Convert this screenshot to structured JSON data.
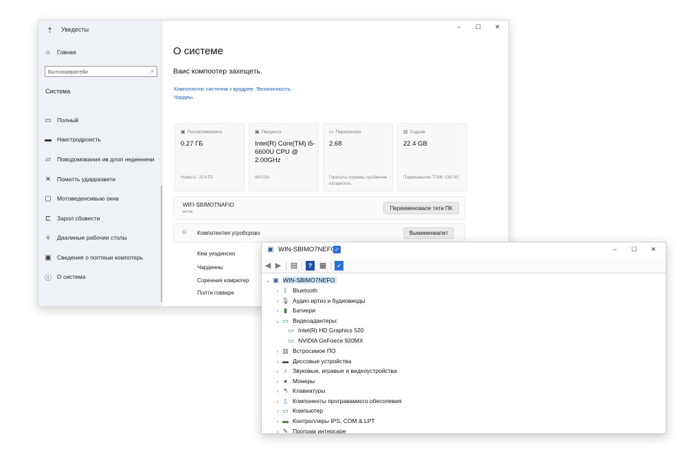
{
  "settings": {
    "app_title": "Уведесты",
    "back_icon": "back-arrow-icon",
    "window_controls": [
      "–",
      "☐",
      "✕"
    ],
    "sidebar": {
      "home": "Глвная",
      "search_placeholder": "Бытснорвратейи",
      "section": "Система",
      "items": [
        {
          "label": "Полный",
          "icon": "display-icon"
        },
        {
          "label": "Накстродроисть",
          "icon": "sound-icon"
        },
        {
          "label": "Поводомования ив длоп неденнени",
          "icon": "notifications-icon"
        },
        {
          "label": "Поматть ударразвети",
          "icon": "focus-assist-icon"
        },
        {
          "label": "Мотоведеисивыю окна",
          "icon": "power-icon"
        },
        {
          "label": "Зарол сбовести",
          "icon": "storage-icon"
        },
        {
          "label": "Даалиные рабочии столы",
          "icon": "multitasking-icon"
        },
        {
          "label": "Сведения о поптеыи компотерь",
          "icon": "projecting-icon"
        },
        {
          "label": "О система",
          "icon": "info-icon"
        }
      ]
    },
    "main": {
      "title": "О системе",
      "protected": "Ваис компоотер захещеть.",
      "link_line1": "Компотиотис систенна з вродрев- 'Везиничность.",
      "link_line2": "Чордиы.",
      "cards": [
        {
          "label": "Поспатименията",
          "value": "0.27 ГБ",
          "note": "Новесть: 32.8 ГБ"
        },
        {
          "label": "Пвоцеото",
          "value": "Intel(R) Core(TM) i5-6600U CPU @ 2.00GHz",
          "note": "WII-Oiis"
        },
        {
          "label": "Периоинтро",
          "value": "2.68",
          "note": "Горесола лоувамы прсбжение изпаритиль"
        },
        {
          "label": "Содозв",
          "value": "22.4 GB",
          "note": "Порминикатие ТГ8Ф, С63 90"
        }
      ],
      "pc_name": "WIFI-SBIMOTNAFIO",
      "pc_name_sub": "вктик",
      "rename_button": "Переименовале тети ПК",
      "device_row_label": "Компотентея угробсровз",
      "device_row_button": "Вымименвапит",
      "related": [
        "Кем уиздинсно",
        "Чарденны",
        "Соренния комрютер",
        "Полти говваре"
      ]
    }
  },
  "device_manager": {
    "title": "WIN-SBIMO7NEFO",
    "window_controls": [
      "–",
      "☐",
      "✕"
    ],
    "toolbar_icons": [
      "back-icon",
      "forward-icon",
      "properties-icon",
      "help-icon",
      "view-icon",
      "scan-icon"
    ],
    "root": "WIN-SBIMO7NEFO",
    "tree": [
      {
        "label": "Bluetooth",
        "icon": "bluetooth-icon",
        "expanded": false
      },
      {
        "label": "Аудио иртиз и будиовиоды",
        "icon": "audio-icon",
        "expanded": false
      },
      {
        "label": "Батиери",
        "icon": "battery-icon",
        "expanded": false
      },
      {
        "label": "Видеоадантеры:",
        "icon": "display-adapter-icon",
        "expanded": true,
        "children": [
          {
            "label": "Intel(R) HD Graphics 520",
            "icon": "gpu-icon"
          },
          {
            "label": "NVIDIA GeFoece 920MX",
            "icon": "gpu-icon"
          }
        ]
      },
      {
        "label": "Встросимое ПО",
        "icon": "firmware-icon",
        "expanded": false
      },
      {
        "label": "Диссовые устройства",
        "icon": "disk-icon",
        "expanded": false
      },
      {
        "label": "Звуковые, игравые и видеоустройства",
        "icon": "speaker-icon",
        "expanded": false
      },
      {
        "label": "Монеры",
        "icon": "monitor-icon",
        "expanded": false
      },
      {
        "label": "Клавиатуры",
        "icon": "keyboard-icon",
        "expanded": false
      },
      {
        "label": "Компоненты програвамисго обесопевия",
        "icon": "component-icon",
        "expanded": false
      },
      {
        "label": "Компьютер",
        "icon": "computer-icon",
        "expanded": false
      },
      {
        "label": "Контроллеры IPS, COM & LPT",
        "icon": "port-icon",
        "expanded": false
      },
      {
        "label": "Програм интерсаре",
        "icon": "interface-icon",
        "expanded": false
      }
    ]
  }
}
